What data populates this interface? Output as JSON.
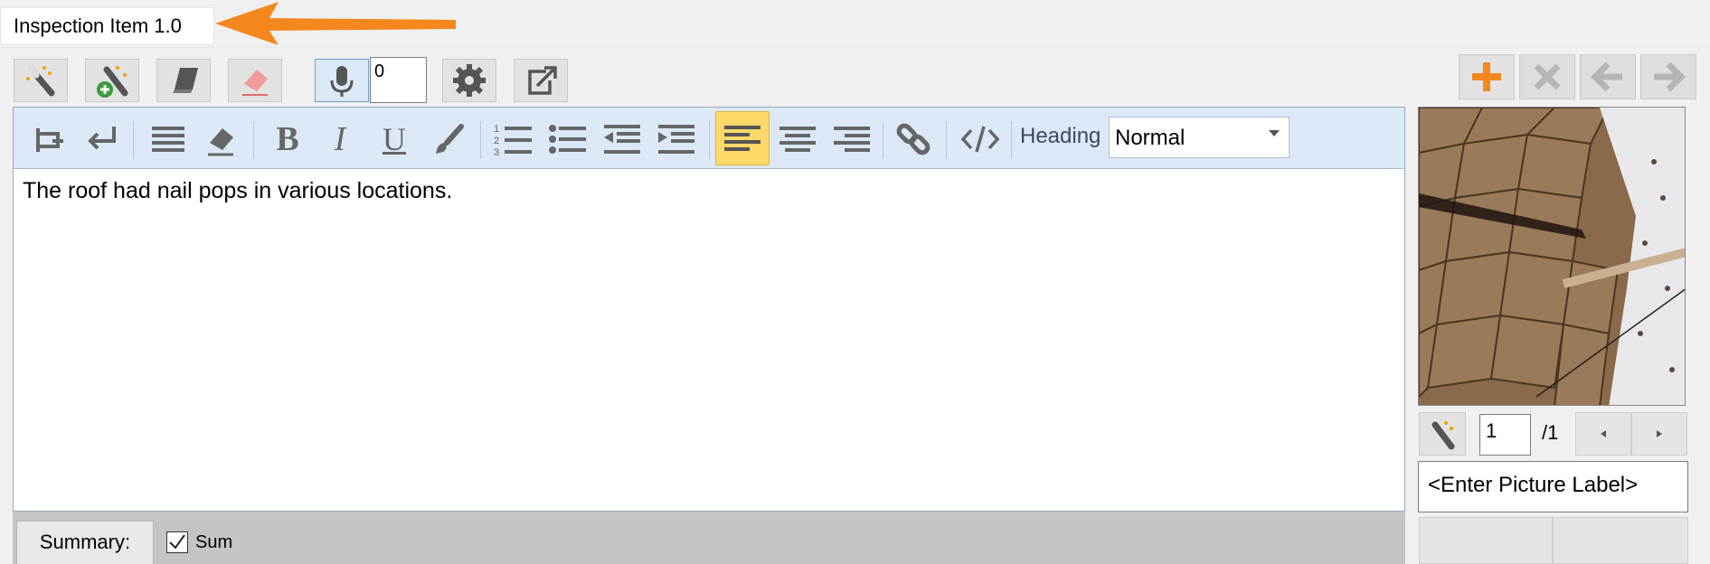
{
  "tab": {
    "title": "Inspection Item 1.0"
  },
  "toolbar": {
    "mic_counter": "0",
    "buttons": [
      "magic-wand",
      "magic-wand-add",
      "book",
      "eraser",
      "microphone",
      "settings",
      "open-external"
    ],
    "right_buttons": [
      "add",
      "delete",
      "back-arrow",
      "forward-arrow"
    ]
  },
  "format_bar": {
    "heading_label": "Heading",
    "heading_value": "Normal"
  },
  "editor": {
    "text": "The roof had nail pops in various locations."
  },
  "summary": {
    "tab_label": "Summary:",
    "checkbox_label": "Sum",
    "checked": true
  },
  "picture": {
    "current": "1",
    "total": "/1",
    "label_placeholder": "<Enter Picture Label>"
  },
  "colors": {
    "accent_orange": "#f5871f",
    "format_bar_bg": "#dce8f6",
    "active_align": "#fdd96a"
  }
}
